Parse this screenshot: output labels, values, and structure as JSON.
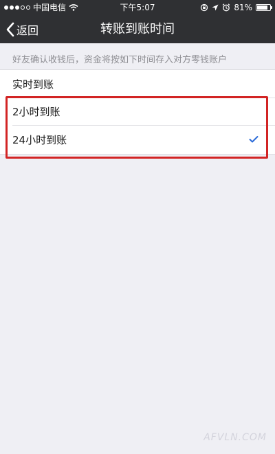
{
  "statusbar": {
    "carrier": "中国电信",
    "time": "下午5:07",
    "battery": "81%"
  },
  "navbar": {
    "back_label": "返回",
    "title": "转账到账时间"
  },
  "hint": "好友确认收钱后，资金将按如下时间存入对方零钱账户",
  "options": [
    {
      "label": "实时到账",
      "selected": false
    },
    {
      "label": "2小时到账",
      "selected": false
    },
    {
      "label": "24小时到账",
      "selected": true
    }
  ],
  "colors": {
    "bar_bg": "#2f3033",
    "page_bg": "#efeff4",
    "check": "#2a6ad8",
    "highlight": "#d22424"
  },
  "watermark": "AFVLN.COM"
}
